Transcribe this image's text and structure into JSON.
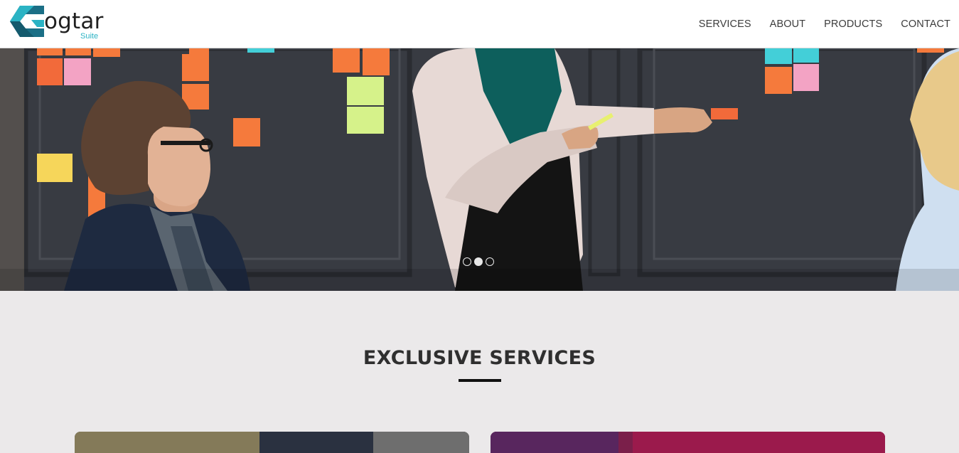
{
  "logo": {
    "word": "ogtar",
    "sub": "Suite",
    "accent": "#2aa6b7"
  },
  "nav": {
    "items": [
      "SERVICES",
      "ABOUT",
      "PRODUCTS",
      "CONTACT"
    ]
  },
  "hero": {
    "slides_total": 3,
    "active_slide": 2
  },
  "services": {
    "title": "EXCLUSIVE SERVICES"
  }
}
